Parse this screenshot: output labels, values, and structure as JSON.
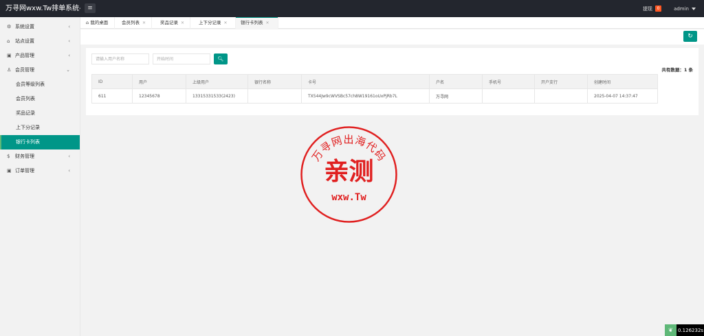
{
  "header": {
    "app_title": "万寻网wxw.Tw排单系统-",
    "menu_icon": "hamburger-icon",
    "withdraw_label": "提现",
    "withdraw_count": "0",
    "user": "admin"
  },
  "sidebar": {
    "items": [
      {
        "label": "系统设置",
        "icon": "gear-icon"
      },
      {
        "label": "站点设置",
        "icon": "home-icon"
      },
      {
        "label": "产品管理",
        "icon": "box-icon"
      },
      {
        "label": "会员管理",
        "icon": "user-icon"
      },
      {
        "label": "财务管理",
        "icon": "dollar-icon"
      },
      {
        "label": "订单管理",
        "icon": "box-icon"
      }
    ],
    "member_subitems": [
      "会员等级列表",
      "会员列表",
      "奖品记录",
      "上下分记录",
      "银行卡列表"
    ]
  },
  "tabs": [
    {
      "label": "我的桌面"
    },
    {
      "label": "会员列表"
    },
    {
      "label": "奖品记录"
    },
    {
      "label": "上下分记录"
    },
    {
      "label": "银行卡列表"
    }
  ],
  "filters": {
    "username_placeholder": "请输入用户名称",
    "start_time_placeholder": "开始时间"
  },
  "total_label": "共有数据：",
  "total_count": "1",
  "total_unit": "条",
  "table": {
    "columns": [
      "ID",
      "用户",
      "上级用户",
      "银行名称",
      "卡号",
      "户名",
      "手机号",
      "开户支行",
      "创建时间"
    ],
    "rows": [
      [
        "611",
        "12345678",
        "13315331533(2423)",
        "",
        "TX544Jw9cWVSBc57ch8W19161oUxPjRb7L",
        "万寻网",
        "",
        "",
        "2025-04-07 14:37:47"
      ]
    ]
  },
  "stamp": {
    "top_text": "万寻网出海代码",
    "main_text": "亲测",
    "bottom_text": "wxw.Tw",
    "color": "#e02020"
  },
  "timer": "0.126232s",
  "colors": {
    "accent": "#009688",
    "header_bg": "#23262e",
    "badge": "#ff5722"
  }
}
